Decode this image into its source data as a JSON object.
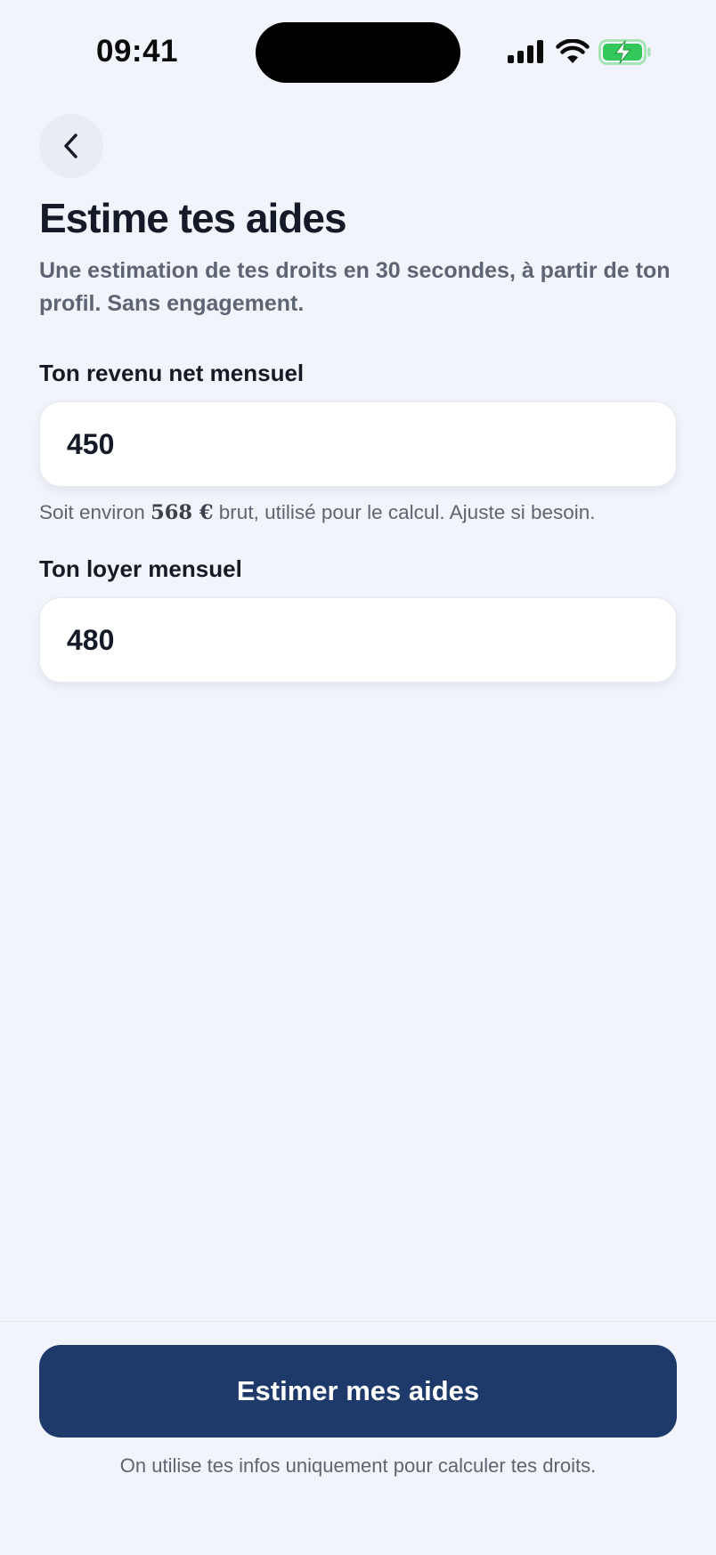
{
  "status_bar": {
    "time": "09:41"
  },
  "header": {
    "title": "Estime tes aides",
    "subtitle": "Une estimation de tes droits en 30 secondes, à partir de ton profil. Sans engagement."
  },
  "form": {
    "income": {
      "label": "Ton revenu net mensuel",
      "value": "450"
    },
    "income_helper": {
      "prefix": "Soit environ ",
      "amount": "568 €",
      "suffix": " brut, utilisé pour le calcul. Ajuste si besoin."
    },
    "rent": {
      "label": "Ton loyer mensuel",
      "value": "480"
    }
  },
  "footer": {
    "submit_label": "Estimer mes aides",
    "note": "On utilise tes infos uniquement pour calculer tes droits."
  },
  "colors": {
    "background": "#f2f4fb",
    "primary": "#1e3a6b",
    "battery_charging": "#34c759"
  },
  "icons": [
    "signal-icon",
    "wifi-icon",
    "battery-charging-icon",
    "chevron-left-icon"
  ]
}
